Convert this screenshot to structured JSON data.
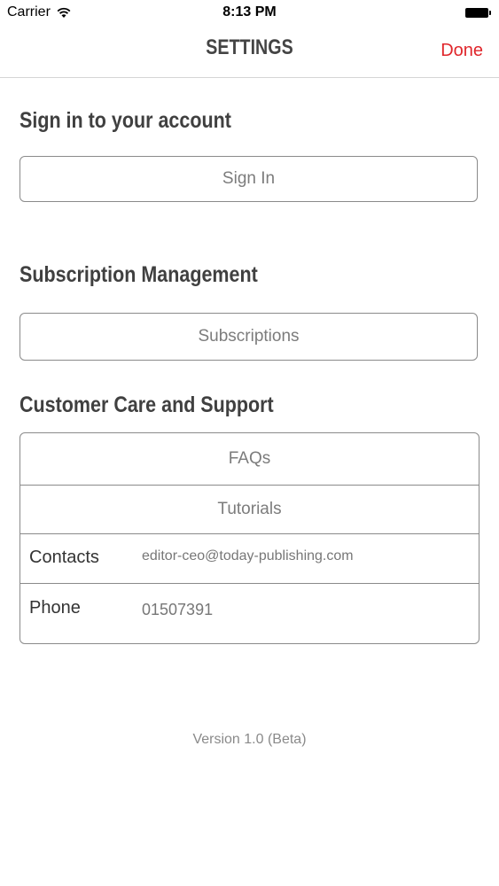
{
  "status_bar": {
    "carrier": "Carrier",
    "time": "8:13 PM",
    "wifi_icon": "wifi-icon",
    "battery_icon": "battery-icon"
  },
  "nav": {
    "title": "SETTINGS",
    "done_label": "Done",
    "done_color": "#e0262b"
  },
  "sign_in": {
    "heading": "Sign in to your account",
    "button_label": "Sign In"
  },
  "subscription": {
    "heading": "Subscription Management",
    "button_label": "Subscriptions"
  },
  "support": {
    "heading": "Customer Care and Support",
    "faqs_label": "FAQs",
    "tutorials_label": "Tutorials",
    "contacts_label": "Contacts",
    "contacts_value": "editor-ceo@today-publishing.com",
    "phone_label": "Phone",
    "phone_value": "01507391"
  },
  "footer": {
    "version": "Version 1.0 (Beta)"
  }
}
